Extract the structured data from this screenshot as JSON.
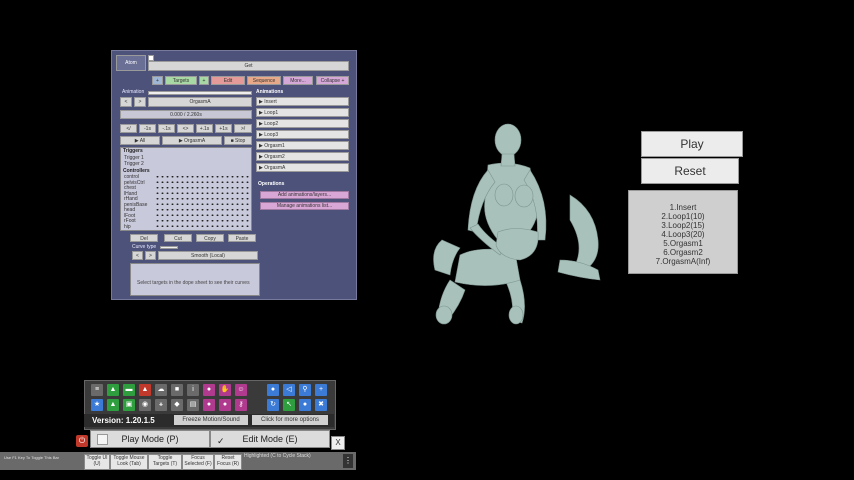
{
  "panel": {
    "tab_atom": "Atom",
    "get_label": "Get",
    "tabs": [
      "Targets",
      "Edit",
      "Sequence",
      "More...",
      "Collapse +"
    ],
    "plus_label": "+",
    "animation_label": "Animation",
    "orgasm_label": "OrgasmA",
    "time_text": "0.000 / 2.260s",
    "step_buttons": [
      "</",
      "-1s",
      "-.1s",
      "<>",
      "+.1s",
      "+1s",
      ">/"
    ],
    "play_all": "▶ All",
    "play_orgasm": "▶ OrgasmA",
    "stop": "■ Stop",
    "triggers_header": "Triggers",
    "triggers": [
      "Trigger 1",
      "Trigger 2"
    ],
    "controllers_header": "Controllers",
    "controllers": [
      "control",
      "pelvisCtrl",
      "chest",
      "lHand",
      "rHand",
      "penisBase",
      "head",
      "lFoot",
      "rFoot",
      "hip"
    ],
    "edit_buttons": [
      "Del",
      "Cut",
      "Copy",
      "Paste"
    ],
    "curve_type": "Curve type",
    "smooth_label": "Smooth (Local)",
    "hint_text": "Select targets in the dope sheet to see their curves",
    "animations_header": "Animations",
    "animations": [
      "▶ Insert",
      "▶ Loop1",
      "▶ Loop2",
      "▶ Loop3",
      "▶ Orgasm1",
      "▶ Orgasm2",
      "▶ OrgasmA"
    ],
    "operations_header": "Operations",
    "operations": [
      "Add animations/layers...",
      "Manage animations list..."
    ]
  },
  "right": {
    "play": "Play",
    "reset": "Reset",
    "sequence": [
      "1.Insert",
      "2.Loop1(10)",
      "3.Loop2(15)",
      "4.Loop3(20)",
      "5.Orgasm1",
      "6.Orgasm2",
      "7.OrgasmA(Inf)"
    ]
  },
  "toolbar": {
    "version": "Version: 1.20.1.5",
    "freeze": "Freeze Motion/Sound",
    "more_options": "Click for more options",
    "play_mode": "Play Mode (P)",
    "edit_mode": "Edit Mode (E)",
    "close": "X",
    "colors": {
      "blue": "#3b7bd6",
      "green": "#2e9e3e",
      "red": "#c0392b",
      "magenta": "#b03a8e",
      "gray": "#6a6a6a"
    }
  },
  "bottom": {
    "left_text": "Use F1 Key To Toggle This Bar",
    "buttons": [
      "Toggle UI (U)",
      "Toggle Mouse Look (Tab)",
      "Toggle Targets (T)",
      "Focus Selected (F)",
      "Reset Focus (R)"
    ],
    "highlight_text": "Highlighted (C to Cycle Stack)"
  }
}
